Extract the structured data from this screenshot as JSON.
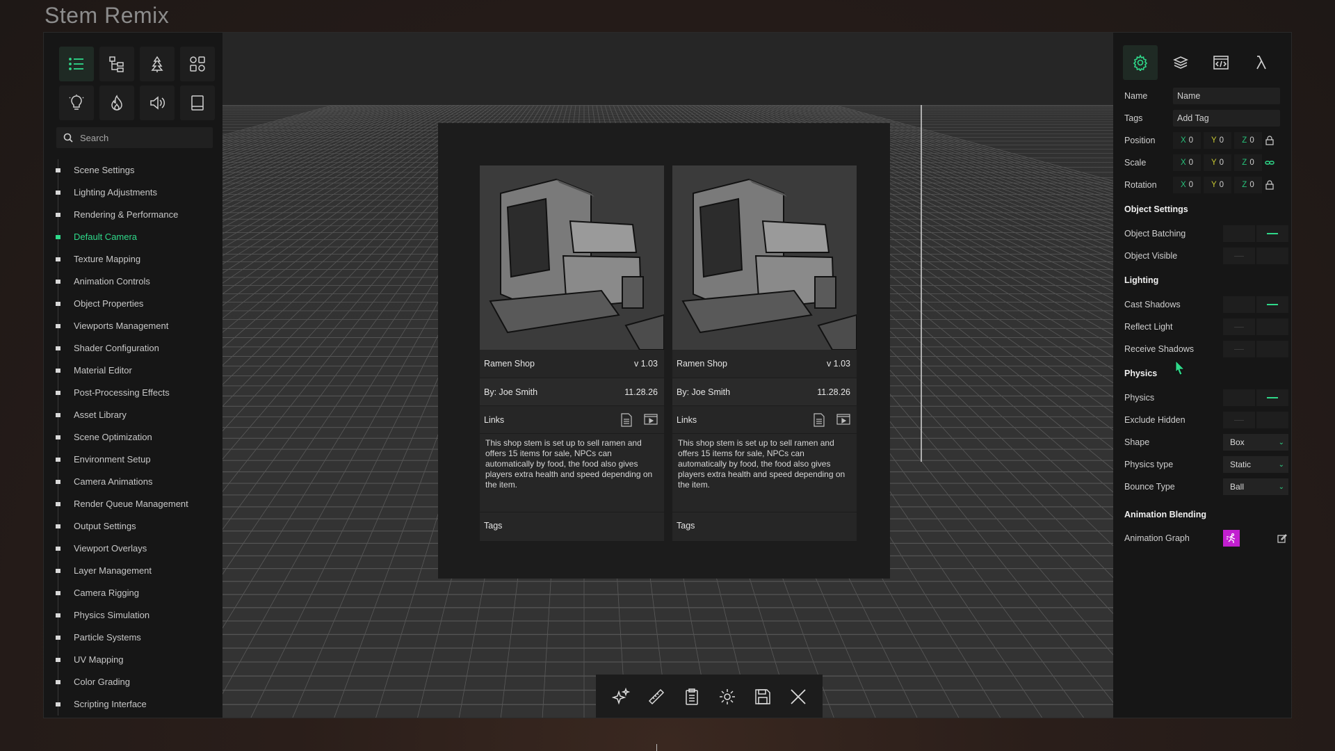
{
  "app": {
    "title": "Stem Remix"
  },
  "sidebar": {
    "tools": [
      {
        "icon": "list-icon",
        "active": true
      },
      {
        "icon": "hierarchy-icon",
        "active": false
      },
      {
        "icon": "tree-icon",
        "active": false
      },
      {
        "icon": "shapes-icon",
        "active": false
      },
      {
        "icon": "lightbulb-icon",
        "active": false
      },
      {
        "icon": "fire-icon",
        "active": false
      },
      {
        "icon": "speaker-icon",
        "active": false
      },
      {
        "icon": "tablet-icon",
        "active": false
      }
    ],
    "search": {
      "placeholder": "Search"
    },
    "items": [
      {
        "label": "Scene Settings"
      },
      {
        "label": "Lighting Adjustments"
      },
      {
        "label": "Rendering & Performance"
      },
      {
        "label": "Default Camera",
        "active": true
      },
      {
        "label": "Texture Mapping"
      },
      {
        "label": "Animation Controls"
      },
      {
        "label": "Object Properties"
      },
      {
        "label": "Viewports Management"
      },
      {
        "label": "Shader Configuration"
      },
      {
        "label": "Material Editor"
      },
      {
        "label": "Post-Processing Effects"
      },
      {
        "label": "Asset Library"
      },
      {
        "label": "Scene Optimization"
      },
      {
        "label": "Environment Setup"
      },
      {
        "label": "Camera Animations"
      },
      {
        "label": "Render Queue Management"
      },
      {
        "label": "Output Settings"
      },
      {
        "label": "Viewport Overlays"
      },
      {
        "label": "Layer Management"
      },
      {
        "label": "Camera Rigging"
      },
      {
        "label": "Physics Simulation"
      },
      {
        "label": "Particle Systems"
      },
      {
        "label": "UV Mapping"
      },
      {
        "label": "Color Grading"
      },
      {
        "label": "Scripting Interface"
      }
    ]
  },
  "modal": {
    "cards": [
      {
        "title": "Ramen Shop",
        "version": "v 1.03",
        "author": "By: Joe Smith",
        "date": "11.28.26",
        "links_label": "Links",
        "description": "This shop stem is set up to sell ramen and offers 15 items for sale, NPCs can automatically by food, the food also gives players extra health and speed depending on the item.",
        "tags_label": "Tags"
      },
      {
        "title": "Ramen Shop",
        "version": "v 1.03",
        "author": "By: Joe Smith",
        "date": "11.28.26",
        "links_label": "Links",
        "description": "This shop stem is set up to sell ramen and offers 15 items for sale, NPCs can automatically by food, the food also gives players extra health and speed depending on the item.",
        "tags_label": "Tags"
      }
    ]
  },
  "toolbar": {
    "tools": [
      "sparkles-icon",
      "ruler-icon",
      "clipboard-icon",
      "gear-icon",
      "save-icon",
      "close-icon"
    ]
  },
  "inspector": {
    "tabs": [
      "gear-icon",
      "layers-icon",
      "code-window-icon",
      "lambda-icon"
    ],
    "name": {
      "label": "Name",
      "placeholder": "Name"
    },
    "tags": {
      "label": "Tags",
      "placeholder": "Add Tag"
    },
    "position": {
      "label": "Position",
      "x": "0",
      "y": "0",
      "z": "0"
    },
    "scale": {
      "label": "Scale",
      "x": "0",
      "y": "0",
      "z": "0"
    },
    "rotation": {
      "label": "Rotation",
      "x": "0",
      "y": "0",
      "z": "0"
    },
    "axis_labels": {
      "x": "X",
      "y": "Y",
      "z": "Z"
    },
    "object_settings": {
      "heading": "Object Settings",
      "batching": {
        "label": "Object Batching",
        "on": true
      },
      "visible": {
        "label": "Object Visible",
        "on": false
      }
    },
    "lighting": {
      "heading": "Lighting",
      "cast_shadows": {
        "label": "Cast Shadows",
        "on": true
      },
      "reflect_light": {
        "label": "Reflect Light",
        "on": false
      },
      "receive_shadows": {
        "label": "Receive Shadows",
        "on": false
      }
    },
    "physics": {
      "heading": "Physics",
      "physics": {
        "label": "Physics",
        "on": true
      },
      "exclude_hidden": {
        "label": "Exclude Hidden",
        "on": false
      },
      "shape": {
        "label": "Shape",
        "value": "Box"
      },
      "physics_type": {
        "label": "Physics type",
        "value": "Static"
      },
      "bounce_type": {
        "label": "Bounce Type",
        "value": "Ball"
      }
    },
    "animation": {
      "heading": "Animation Blending",
      "graph": {
        "label": "Animation Graph"
      }
    }
  },
  "colors": {
    "accent": "#2fd98a",
    "magenta": "#c21fd0"
  }
}
